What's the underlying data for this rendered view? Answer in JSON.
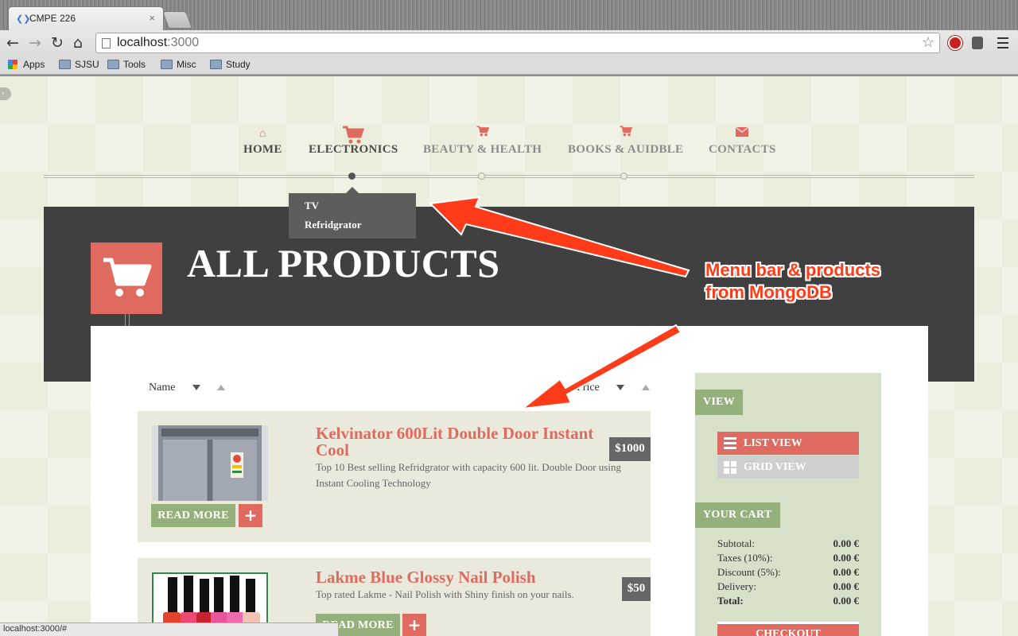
{
  "browser": {
    "tab_title": "CMPE 226",
    "url_host": "localhost",
    "url_port": ":3000",
    "bookmarks": [
      "Apps",
      "SJSU",
      "Tools",
      "Misc",
      "Study"
    ],
    "status_url": "localhost:3000/#"
  },
  "nav": {
    "items": [
      {
        "label": "HOME",
        "icon": "home-icon"
      },
      {
        "label": "ELECTRONICS",
        "icon": "cart-icon"
      },
      {
        "label": "BEAUTY & HEALTH",
        "icon": "cart-icon"
      },
      {
        "label": "BOOKS & AUIDBLE",
        "icon": "cart-icon"
      },
      {
        "label": "CONTACTS",
        "icon": "mail-icon"
      }
    ],
    "active": "ELECTRONICS",
    "dropdown": [
      "TV",
      "Refridgrator"
    ]
  },
  "hero": {
    "title": "ALL PRODUCTS"
  },
  "sort": {
    "name_label": "Name",
    "price_label": "Price"
  },
  "products": [
    {
      "title": "Kelvinator 600Lit Double Door Instant Cool",
      "description": "Top 10 Best selling Refridgrator with capacity 600 lit. Double Door using Instant Cooling Technology",
      "price": "$1000",
      "read_more": "READ MORE",
      "add": "+"
    },
    {
      "title": "Lakme Blue Glossy Nail Polish",
      "description": "Top rated Lakme - Nail Polish with Shiny finish on your nails.",
      "price": "$50",
      "read_more": "READ MORE",
      "add": "+"
    }
  ],
  "sidebar": {
    "view_heading": "VIEW",
    "list_view": "LIST VIEW",
    "grid_view": "GRID VIEW",
    "cart_heading": "YOUR CART",
    "totals": [
      {
        "label": "Subtotal:",
        "value": "0.00 €"
      },
      {
        "label": "Taxes (10%):",
        "value": "0.00 €"
      },
      {
        "label": "Discount (5%):",
        "value": "0.00 €"
      },
      {
        "label": "Delivery:",
        "value": "0.00 €"
      },
      {
        "label": "Total:",
        "value": "0.00 €"
      }
    ],
    "checkout": "CHECKOUT"
  },
  "annotation": {
    "line1": "Menu bar & products",
    "line2": "from  MongoDB"
  },
  "colors": {
    "accent": "#df6a5f",
    "green": "#96b07c",
    "dark": "#404040",
    "annotation": "#ff3b1a"
  }
}
